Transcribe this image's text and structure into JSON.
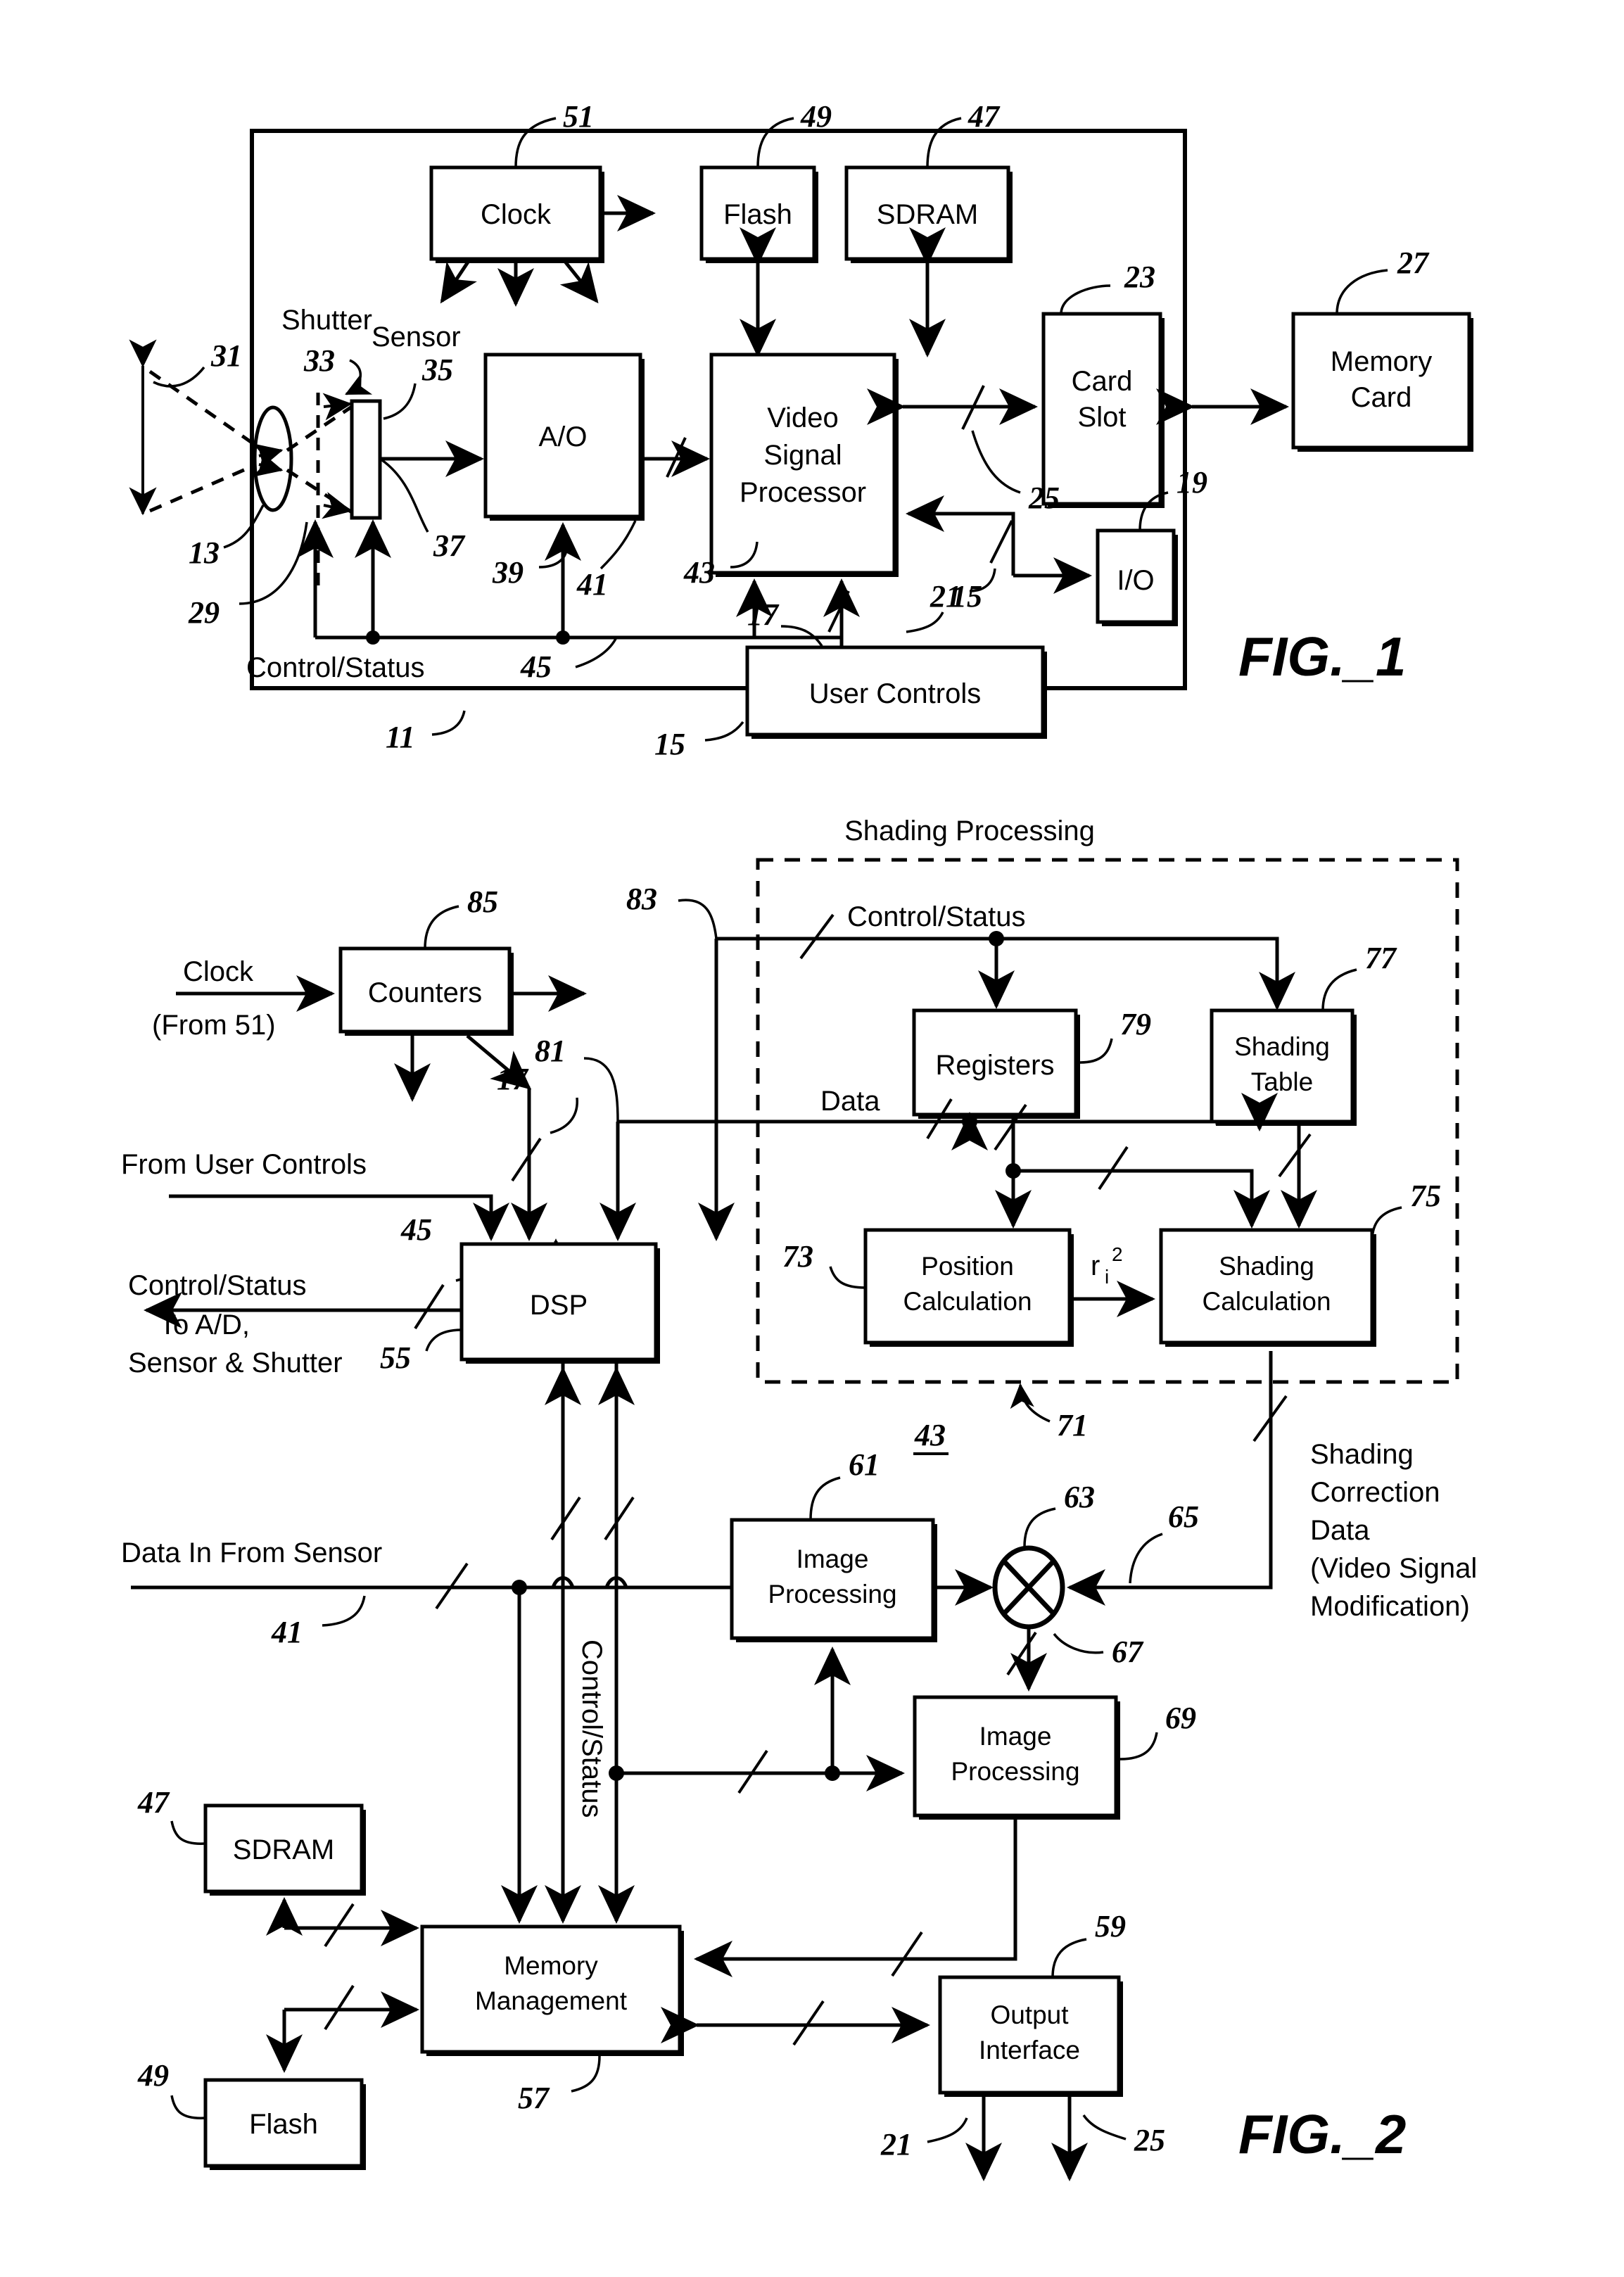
{
  "document": {
    "type": "patent-drawing-sheet",
    "figures": [
      "FIG._1",
      "FIG._2"
    ]
  },
  "fig1": {
    "caption": "FIG._1",
    "blocks": {
      "clock": "Clock",
      "flash": "Flash",
      "sdram": "SDRAM",
      "ao": "A/O",
      "vsp_line1": "Video",
      "vsp_line2": "Signal",
      "vsp_line3": "Processor",
      "card_slot_line1": "Card",
      "card_slot_line2": "Slot",
      "memory_card_line1": "Memory",
      "memory_card_line2": "Card",
      "io": "I/O",
      "user_controls": "User Controls"
    },
    "labels": {
      "shutter": "Shutter",
      "sensor": "Sensor",
      "control_status": "Control/Status"
    },
    "refs": {
      "r51": "51",
      "r49": "49",
      "r47": "47",
      "r23": "23",
      "r27": "27",
      "r31": "31",
      "r33": "33",
      "r35": "35",
      "r13": "13",
      "r29": "29",
      "r37": "37",
      "r39": "39",
      "r41": "41",
      "r43": "43",
      "r45": "45",
      "r25": "25",
      "r19": "19",
      "r21": "21",
      "r17": "17",
      "r15_top": "15",
      "r15_bottom": "15",
      "r11": "11"
    }
  },
  "fig2": {
    "caption": "FIG._2",
    "blocks": {
      "counters": "Counters",
      "registers": "Registers",
      "shading_table_line1": "Shading",
      "shading_table_line2": "Table",
      "position_calc_line1": "Position",
      "position_calc_line2": "Calculation",
      "shading_calc_line1": "Shading",
      "shading_calc_line2": "Calculation",
      "dsp": "DSP",
      "image_processing_61_line1": "Image",
      "image_processing_61_line2": "Processing",
      "image_processing_69_line1": "Image",
      "image_processing_69_line2": "Processing",
      "sdram": "SDRAM",
      "flash": "Flash",
      "memory_mgmt_line1": "Memory",
      "memory_mgmt_line2": "Management",
      "output_interface_line1": "Output",
      "output_interface_line2": "Interface"
    },
    "labels": {
      "shading_processing": "Shading Processing",
      "control_status_top": "Control/Status",
      "data": "Data",
      "clock_line1": "Clock",
      "clock_line2": "(From 51)",
      "from_user_controls": "From User Controls",
      "control_status_left": "Control/Status",
      "to_ad_line1": "To A/D,",
      "to_ad_line2": "Sensor & Shutter",
      "data_in_from_sensor": "Data In From Sensor",
      "control_status_vertical": "Control/Status",
      "ri2_base": "r",
      "ri2_sub": "i",
      "ri2_sup": "2",
      "shading_corr_line1": "Shading",
      "shading_corr_line2": "Correction",
      "shading_corr_line3": "Data",
      "shading_corr_line4": "(Video Signal",
      "shading_corr_line5": "Modification)"
    },
    "refs": {
      "r85": "85",
      "r83": "83",
      "r81": "81",
      "r77": "77",
      "r79": "79",
      "r75": "75",
      "r73": "73",
      "r71": "71",
      "r43": "43",
      "r17": "17",
      "r45": "45",
      "r55": "55",
      "r61": "61",
      "r63": "63",
      "r65": "65",
      "r67": "67",
      "r69": "69",
      "r41": "41",
      "r47": "47",
      "r49": "49",
      "r57": "57",
      "r59": "59",
      "r21": "21",
      "r25": "25"
    }
  },
  "colors": {
    "ink": "#000000",
    "paper": "#ffffff"
  }
}
